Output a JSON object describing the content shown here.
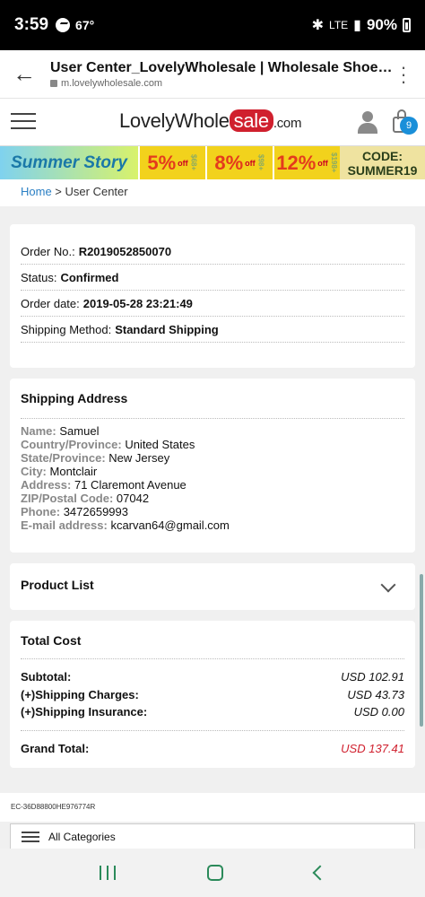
{
  "statusbar": {
    "time": "3:59",
    "temperature": "67°",
    "network": "LTE",
    "battery": "90%"
  },
  "browser": {
    "page_title": "User Center_LovelyWholesale | Wholesale Shoes...",
    "host": "m.lovelywholesale.com"
  },
  "site": {
    "logo_main": "LovelyWhole",
    "logo_sale": "sale",
    "logo_suffix": ".com",
    "cart_count": "9"
  },
  "banner": {
    "summer": "Summer Story",
    "offers": [
      {
        "pct": "5%",
        "off": "off",
        "min": "$68+"
      },
      {
        "pct": "8%",
        "off": "off",
        "min": "$98+"
      },
      {
        "pct": "12%",
        "off": "off",
        "min": "$198+"
      }
    ],
    "code_label": "CODE:",
    "code_value": "SUMMER19"
  },
  "breadcrumb": {
    "home": "Home",
    "sep": " > ",
    "current": "User Center"
  },
  "order": {
    "number_label": "Order No.:",
    "number": "R2019052850070",
    "status_label": "Status:",
    "status": "Confirmed",
    "date_label": "Order date:",
    "date": "2019-05-28 23:21:49",
    "shipping_label": "Shipping Method:",
    "shipping": "Standard Shipping"
  },
  "address": {
    "title": "Shipping Address",
    "fields": [
      {
        "k": "Name:",
        "v": "Samuel"
      },
      {
        "k": "Country/Province:",
        "v": "United States"
      },
      {
        "k": "State/Province:",
        "v": "New Jersey"
      },
      {
        "k": "City:",
        "v": "Montclair"
      },
      {
        "k": "Address:",
        "v": "71 Claremont Avenue"
      },
      {
        "k": "ZIP/Postal Code:",
        "v": "07042"
      },
      {
        "k": "Phone:",
        "v": "3472659993"
      },
      {
        "k": "E-mail address:",
        "v": "kcarvan64@gmail.com"
      }
    ]
  },
  "product_list": {
    "title": "Product List"
  },
  "cost": {
    "title": "Total Cost",
    "subtotal_label": "Subtotal:",
    "subtotal": "USD 102.91",
    "shipping_label": "(+)Shipping Charges:",
    "shipping": "USD 43.73",
    "insurance_label": "(+)Shipping Insurance:",
    "insurance": "USD 0.00",
    "grand_label": "Grand Total:",
    "grand": "USD 137.41"
  },
  "footer": {
    "id": "EC-36D88800HE976774R",
    "all_categories": "All Categories"
  },
  "colors": {
    "accent_red": "#d0202e",
    "link_blue": "#2a7fc4",
    "badge_blue": "#1a8fd9"
  }
}
